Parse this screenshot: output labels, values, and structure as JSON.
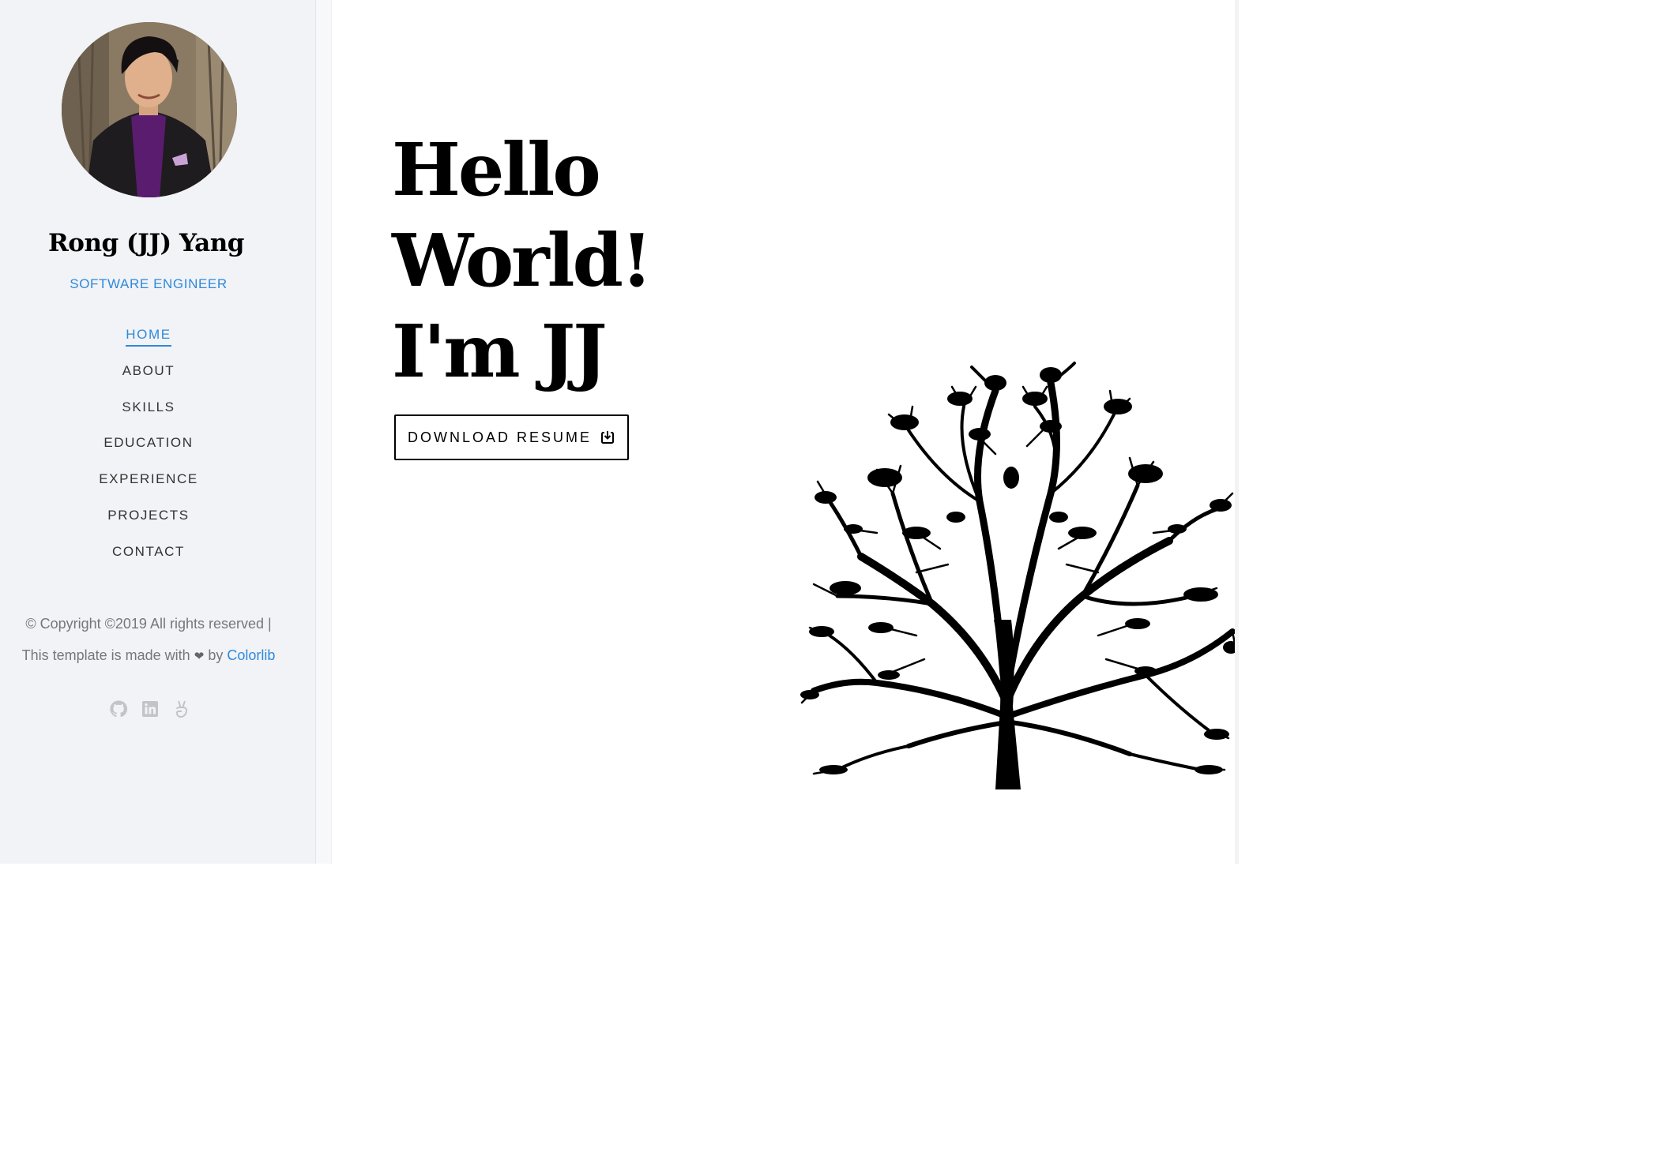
{
  "profile": {
    "name": "Rong (JJ) Yang",
    "role": "SOFTWARE ENGINEER",
    "avatar_icon": "profile-photo"
  },
  "nav": {
    "items": [
      {
        "label": "HOME",
        "active": true
      },
      {
        "label": "ABOUT",
        "active": false
      },
      {
        "label": "SKILLS",
        "active": false
      },
      {
        "label": "EDUCATION",
        "active": false
      },
      {
        "label": "EXPERIENCE",
        "active": false
      },
      {
        "label": "PROJECTS",
        "active": false
      },
      {
        "label": "CONTACT",
        "active": false
      }
    ]
  },
  "footer": {
    "copyright": "© Copyright ©2019 All rights reserved |",
    "made_with_prefix": "This template is made with",
    "heart": "❤",
    "by": "by",
    "link_text": "Colorlib"
  },
  "social": [
    "github-icon",
    "linkedin-icon",
    "angellist-icon"
  ],
  "hero": {
    "line1": "Hello",
    "line2": "World!",
    "line3": "I'm JJ",
    "button_label": "DOWNLOAD RESUME",
    "button_icon": "download-icon"
  },
  "colors": {
    "accent": "#2f89d9",
    "sidebar_bg": "#f1f3f7",
    "text": "#000000"
  }
}
